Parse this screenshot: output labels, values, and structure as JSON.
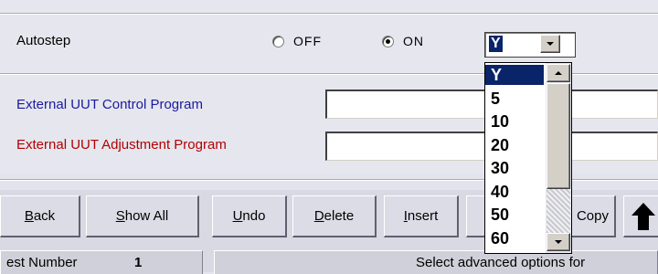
{
  "autostep": {
    "label": "Autostep",
    "off_label": "OFF",
    "on_label": "ON",
    "selected": "ON",
    "combo_value": "Y"
  },
  "external_control": {
    "label": "External UUT Control Program",
    "value": ""
  },
  "external_adjustment": {
    "label": "External UUT Adjustment Program",
    "value": ""
  },
  "dropdown_options": [
    "Y",
    "5",
    "10",
    "20",
    "30",
    "40",
    "50",
    "60"
  ],
  "toolbar": {
    "back": {
      "accel": "B",
      "rest": "ack"
    },
    "show_all": {
      "accel": "S",
      "rest": "how All"
    },
    "undo": {
      "accel": "U",
      "rest": "ndo"
    },
    "delete": {
      "accel": "D",
      "rest": "elete"
    },
    "insert": {
      "accel": "I",
      "rest": "nsert"
    },
    "copy": {
      "text": "Copy"
    }
  },
  "status": {
    "test_number_label": "est Number",
    "test_number_value": "1",
    "message": "Select advanced options for"
  },
  "colors": {
    "label_blue": "#1a1aa0",
    "label_red": "#b00000",
    "selection": "#0a246a"
  }
}
